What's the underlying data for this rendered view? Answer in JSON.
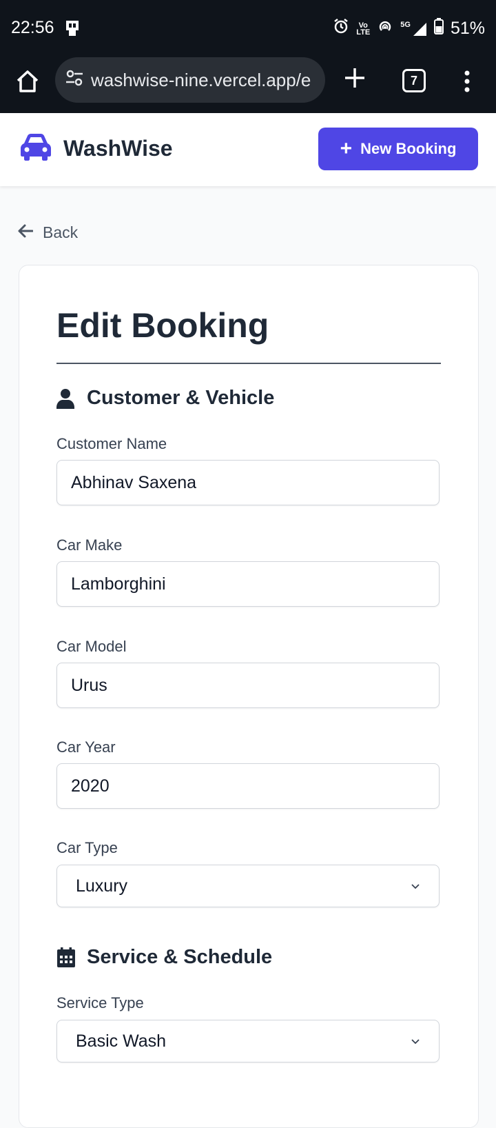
{
  "status": {
    "time": "22:56",
    "battery": "51%",
    "network": "5G",
    "volte_top": "Vo",
    "volte_bottom": "LTE"
  },
  "browser": {
    "url": "washwise-nine.vercel.app/e",
    "tab_count": "7"
  },
  "header": {
    "brand": "WashWise",
    "new_booking_label": "New Booking"
  },
  "back_label": "Back",
  "form": {
    "title": "Edit Booking",
    "section_customer": "Customer & Vehicle",
    "section_service": "Service & Schedule",
    "fields": {
      "customer_name": {
        "label": "Customer Name",
        "value": "Abhinav Saxena"
      },
      "car_make": {
        "label": "Car Make",
        "value": "Lamborghini"
      },
      "car_model": {
        "label": "Car Model",
        "value": "Urus"
      },
      "car_year": {
        "label": "Car Year",
        "value": "2020"
      },
      "car_type": {
        "label": "Car Type",
        "value": "Luxury"
      },
      "service_type": {
        "label": "Service Type",
        "value": "Basic Wash"
      }
    }
  },
  "colors": {
    "accent": "#4f46e5",
    "status_bg": "#0f141b",
    "text_dark": "#1f2937"
  }
}
